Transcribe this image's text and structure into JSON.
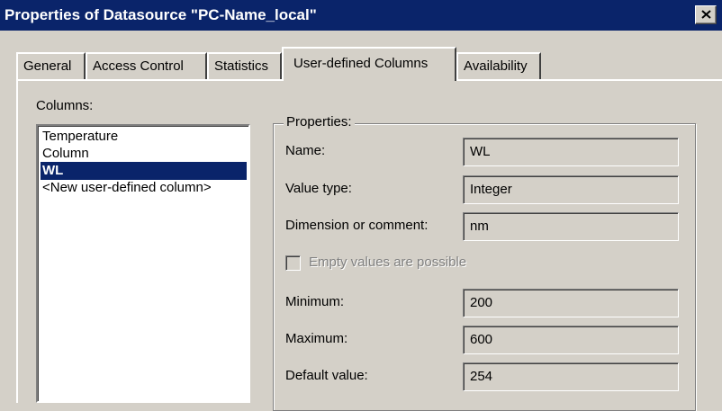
{
  "window": {
    "title": "Properties of Datasource \"PC-Name_local\"",
    "close_icon": "close-icon"
  },
  "tabs": [
    {
      "label": "General"
    },
    {
      "label": "Access Control"
    },
    {
      "label": "Statistics"
    },
    {
      "label": "User-defined Columns",
      "active": true
    },
    {
      "label": "Availability"
    }
  ],
  "columns": {
    "label": "Columns:",
    "items": [
      "Temperature",
      "Column",
      "WL",
      "<New user-defined column>"
    ],
    "selected": "WL"
  },
  "properties": {
    "group_label": "Properties:",
    "name_label": "Name:",
    "name_value": "WL",
    "value_type_label": "Value type:",
    "value_type_value": "Integer",
    "dimension_label": "Dimension or comment:",
    "dimension_value": "nm",
    "empty_values_label": "Empty values are possible",
    "empty_values_checked": false,
    "minimum_label": "Minimum:",
    "minimum_value": "200",
    "maximum_label": "Maximum:",
    "maximum_value": "600",
    "default_label": "Default value:",
    "default_value": "254"
  },
  "colors": {
    "titlebar": "#0a246a",
    "face": "#d4d0c8",
    "selection": "#0a246a"
  }
}
